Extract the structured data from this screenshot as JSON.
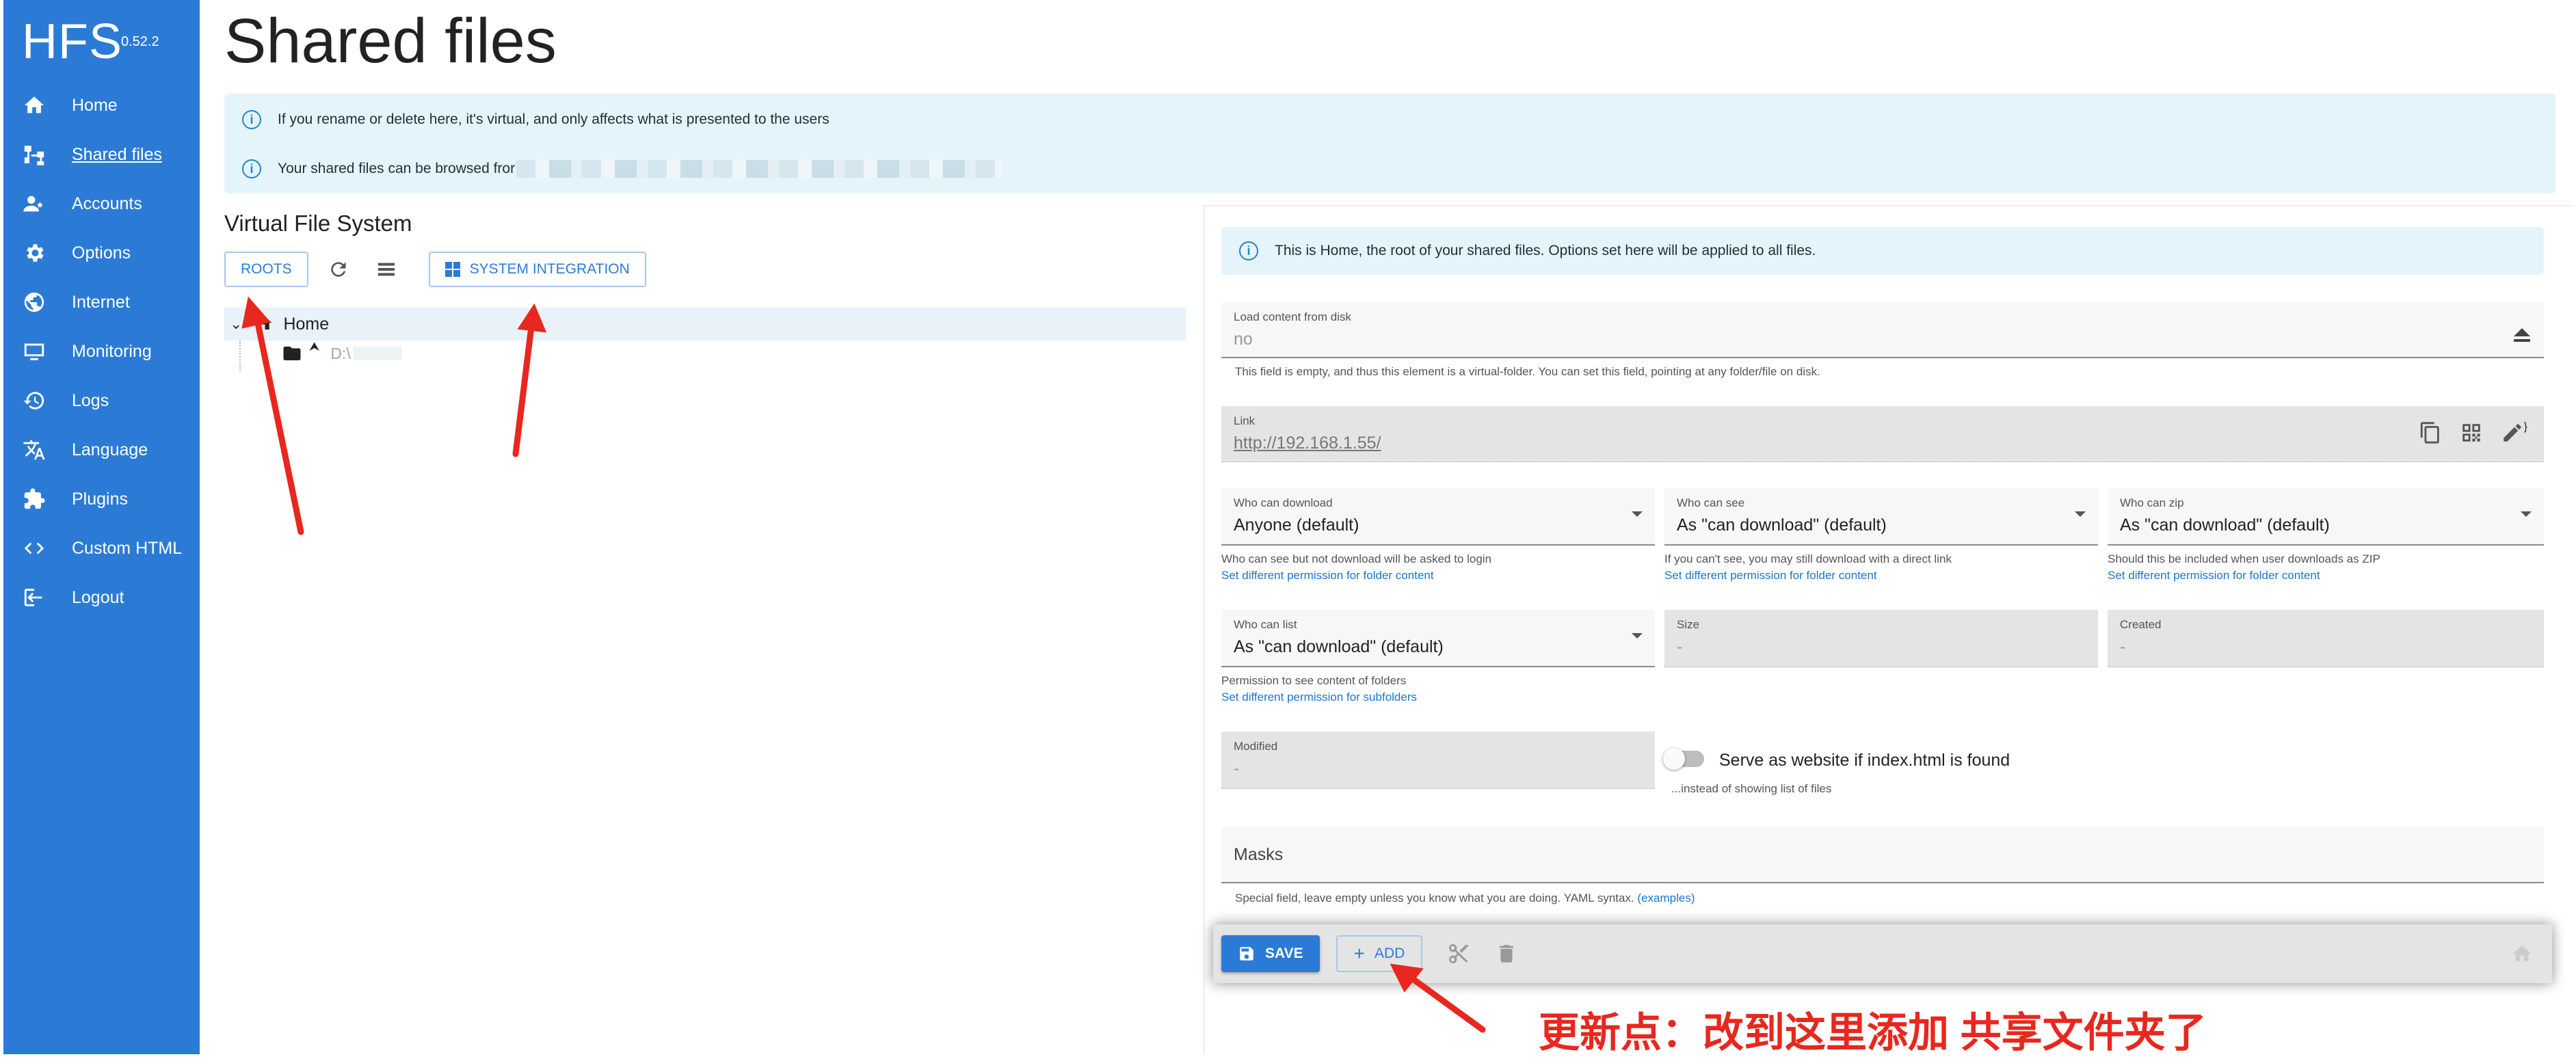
{
  "app": {
    "name": "HFS",
    "version": "0.52.2"
  },
  "sidebar": {
    "items": [
      {
        "label": "Home",
        "icon": "home-icon"
      },
      {
        "label": "Shared files",
        "icon": "sitemap-icon",
        "active": true
      },
      {
        "label": "Accounts",
        "icon": "accounts-icon"
      },
      {
        "label": "Options",
        "icon": "gear-icon"
      },
      {
        "label": "Internet",
        "icon": "globe-icon"
      },
      {
        "label": "Monitoring",
        "icon": "monitor-icon"
      },
      {
        "label": "Logs",
        "icon": "history-icon"
      },
      {
        "label": "Language",
        "icon": "translate-icon"
      },
      {
        "label": "Plugins",
        "icon": "puzzle-icon"
      },
      {
        "label": "Custom HTML",
        "icon": "code-icon"
      },
      {
        "label": "Logout",
        "icon": "logout-icon"
      }
    ]
  },
  "page": {
    "title": "Shared files"
  },
  "info": {
    "line1": "If you rename or delete here, it's virtual, and only affects what is presented to the users",
    "line2": "Your shared files can be browsed fror"
  },
  "vfs": {
    "title": "Virtual File System",
    "roots_label": "ROOTS",
    "system_integration_label": "SYSTEM INTEGRATION",
    "tree": {
      "root": "Home",
      "child": "D:\\"
    }
  },
  "panel": {
    "info": "This is Home, the root of your shared files. Options set here will be applied to all files.",
    "load_content": {
      "label": "Load content from disk",
      "value": "no",
      "helper": "This field is empty, and thus this element is a virtual-folder. You can set this field, pointing at any folder/file on disk."
    },
    "link": {
      "label": "Link",
      "value": "http://192.168.1.55/"
    },
    "who_can_download": {
      "label": "Who can download",
      "value": "Anyone (default)",
      "helper": "Who can see but not download will be asked to login",
      "link": "Set different permission for folder content"
    },
    "who_can_see": {
      "label": "Who can see",
      "value": "As \"can download\" (default)",
      "helper": "If you can't see, you may still download with a direct link",
      "link": "Set different permission for folder content"
    },
    "who_can_zip": {
      "label": "Who can zip",
      "value": "As \"can download\" (default)",
      "helper": "Should this be included when user downloads as ZIP",
      "link": "Set different permission for folder content"
    },
    "who_can_list": {
      "label": "Who can list",
      "value": "As \"can download\" (default)",
      "helper": "Permission to see content of folders",
      "link": "Set different permission for subfolders"
    },
    "size": {
      "label": "Size",
      "value": "-"
    },
    "created": {
      "label": "Created",
      "value": "-"
    },
    "modified": {
      "label": "Modified",
      "value": "-"
    },
    "serve_website": {
      "label": "Serve as website if index.html is found",
      "helper": "...instead of showing list of files",
      "enabled": false
    },
    "masks": {
      "label": "Masks",
      "helper": "Special field, leave empty unless you know what you are doing. YAML syntax.",
      "examples": "(examples)"
    }
  },
  "footer": {
    "save_label": "SAVE",
    "add_label": "ADD"
  },
  "annotation": {
    "text": "更新点：改到这里添加 共享文件夹了"
  },
  "colors": {
    "sidebar": "#2b7bd6",
    "accent": "#1976d2",
    "info_bg": "#e5f4fb",
    "annotation": "#e8271e"
  }
}
